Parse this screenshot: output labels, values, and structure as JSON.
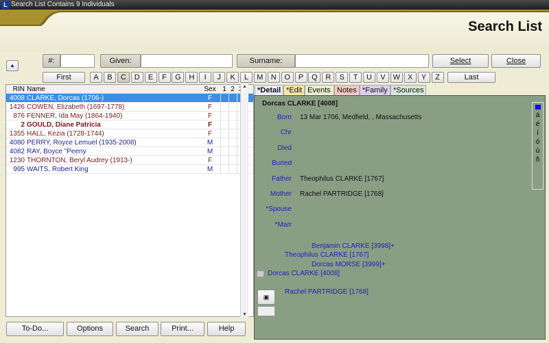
{
  "window": {
    "title": "Search List Contains 9 Individuals",
    "app_icon": "L"
  },
  "page_title": "Search List",
  "filters": {
    "number_label": "#:",
    "number_value": "",
    "given_label": "Given:",
    "given_value": "",
    "surname_label": "Surname:",
    "surname_value": "",
    "select": "Select",
    "close": "Close",
    "first": "First",
    "last": "Last",
    "active_letter": "C",
    "letters": [
      "A",
      "B",
      "C",
      "D",
      "E",
      "F",
      "G",
      "H",
      "I",
      "J",
      "K",
      "L",
      "M",
      "N",
      "O",
      "P",
      "Q",
      "R",
      "S",
      "T",
      "U",
      "V",
      "W",
      "X",
      "Y",
      "Z"
    ]
  },
  "list": {
    "headers": {
      "rin": "RIN",
      "name": "Name",
      "sex": "Sex",
      "c1": "1",
      "c2": "2",
      "c3": "3"
    },
    "rows": [
      {
        "rin": "4008",
        "name": "CLARKE, Dorcas (1706-)",
        "sex": "F",
        "selected": true
      },
      {
        "rin": "1426",
        "name": "COWEN, Elizabeth (1697-1778)",
        "sex": "F"
      },
      {
        "rin": "876",
        "name": "FENNER, Ida May (1864-1940)",
        "sex": "F"
      },
      {
        "rin": "2",
        "name": "GOULD, Diane Patricia",
        "sex": "F",
        "bold": true
      },
      {
        "rin": "1355",
        "name": "HALL, Kezia (1728-1744)",
        "sex": "F"
      },
      {
        "rin": "4080",
        "name": "PERRY, Royce Lemuel (1935-2008)",
        "sex": "M"
      },
      {
        "rin": "4082",
        "name": "RAY, Boyce \"Peeny",
        "sex": "M"
      },
      {
        "rin": "1230",
        "name": "THORNTON, Beryl Audrey (1913-)",
        "sex": "F"
      },
      {
        "rin": "995",
        "name": "WAITS, Robert King",
        "sex": "M"
      }
    ]
  },
  "tabs": [
    "*Detail",
    "*Edit",
    "Events",
    "Notes",
    "*Family",
    "*Sources"
  ],
  "detail": {
    "heading": "Dorcas CLARKE [4008]",
    "fields": [
      {
        "label": "Born",
        "value": "13 Mar 1706, Medfield, , Massachusetts"
      },
      {
        "label": "Chr",
        "value": ""
      },
      {
        "label": "Died",
        "value": ""
      },
      {
        "label": "Buried",
        "value": ""
      },
      {
        "label": "Father",
        "value": "Theophilus CLARKE [1767]"
      },
      {
        "label": "Mother",
        "value": "Rachel PARTRIDGE [1768]"
      },
      {
        "label": "*Spouse",
        "value": ""
      },
      {
        "label": "*Marr",
        "value": ""
      }
    ],
    "pedigree": {
      "ggf": "Benjamin CLARKE [3998]+",
      "father": "Theophilus CLARKE [1767]",
      "ggm": "Dorcas MORSE [3999]+",
      "self": "Dorcas CLARKE [4008]",
      "mother": "Rachel PARTRIDGE [1768]"
    },
    "accents": [
      "á",
      "é",
      "í",
      "ó",
      "ú",
      "ñ"
    ]
  },
  "bottom_buttons": [
    "To-Do...",
    "Options",
    "Search",
    "Print...",
    "Help"
  ]
}
